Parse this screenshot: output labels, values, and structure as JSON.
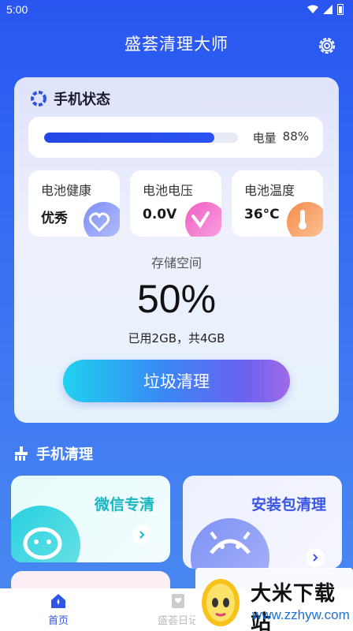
{
  "status_bar": {
    "time": "5:00"
  },
  "app": {
    "title": "盛荟清理大师"
  },
  "phone_status": {
    "title": "手机状态",
    "battery": {
      "label": "电量",
      "value_text": "88%",
      "level": 0.88
    },
    "cards": [
      {
        "label": "电池健康",
        "value": "优秀",
        "icon": "heart-icon",
        "color": "#9aa9f7"
      },
      {
        "label": "电池电压",
        "value": "0.0V",
        "icon": "check-icon",
        "color": "#f27fcf"
      },
      {
        "label": "电池温度",
        "value": "36°C",
        "icon": "thermometer-icon",
        "color": "#f7a66a"
      }
    ],
    "storage": {
      "label": "存储空间",
      "percent_text": "50%",
      "detail": "已用2GB，共4GB",
      "percent": 50
    },
    "clean_button": "垃圾清理"
  },
  "phone_clean": {
    "title": "手机清理",
    "items": [
      {
        "title": "微信专清",
        "icon": "wechat-icon"
      },
      {
        "title": "安装包清理",
        "icon": "android-icon"
      }
    ]
  },
  "bottom_nav": [
    {
      "label": "首页",
      "icon": "home-icon",
      "active": true
    },
    {
      "label": "盛荟日记",
      "icon": "diary-icon",
      "active": false
    }
  ],
  "watermark": {
    "title": "大米下载站",
    "url": "www.zzhyw.com"
  },
  "colors": {
    "primary": "#2f55e8",
    "background": "#2a55f0"
  }
}
